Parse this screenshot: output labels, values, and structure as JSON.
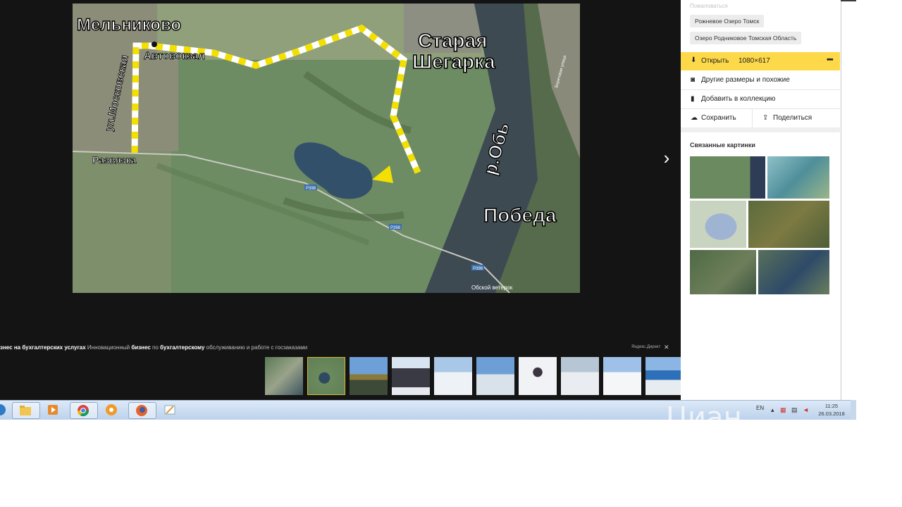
{
  "viewer": {
    "map_labels": {
      "melnikovo": "Мельниково",
      "avtovokzal": "Автовокзал",
      "street": "ул.Московская",
      "razvyazka": "Развязка",
      "staraya": "Старая",
      "shegarka": "Шегарка",
      "river": "р.Обь",
      "pobeda": "Победа",
      "road1": "Р398",
      "road2": "Р398",
      "road3": "Р398",
      "copyright": "Обской ветерок",
      "riverside": "Береговая улица"
    },
    "next_icon": "chevron-right-icon"
  },
  "ad": {
    "part1": "знес на бухгалтерских услугах",
    "part2": " Инновационный ",
    "part3": "бизнес",
    "part4": " по ",
    "part5": "бухгалтерскому",
    "part6": " обслуживанию и работе с госзаказами",
    "tag": "Яндекс.Директ",
    "close": "✕"
  },
  "thumbnails": [
    {
      "name": "thumb-1"
    },
    {
      "name": "thumb-2",
      "selected": true
    },
    {
      "name": "thumb-3"
    },
    {
      "name": "thumb-4"
    },
    {
      "name": "thumb-5"
    },
    {
      "name": "thumb-6"
    },
    {
      "name": "thumb-7"
    },
    {
      "name": "thumb-8"
    },
    {
      "name": "thumb-9"
    },
    {
      "name": "thumb-10"
    }
  ],
  "panel": {
    "complain": "Пожаловаться",
    "tags": [
      "Рожневое Озеро Томск",
      "Озеро Родниковое Томская Область"
    ],
    "open": {
      "label": "Открыть",
      "size": "1080×617",
      "more": "•••"
    },
    "other_sizes": "Другие размеры и похожие",
    "add_collection": "Добавить в коллекцию",
    "save": "Сохранить",
    "share": "Поделиться",
    "related_title": "Связанные картинки"
  },
  "taskbar": {
    "lang": "EN",
    "time": "11:25",
    "date": "26.03.2018",
    "apps": [
      "start-icon",
      "explorer-icon",
      "media-player-icon",
      "chrome-icon",
      "settings-icon",
      "firefox-icon",
      "paint-icon"
    ]
  },
  "watermark": "Циан"
}
